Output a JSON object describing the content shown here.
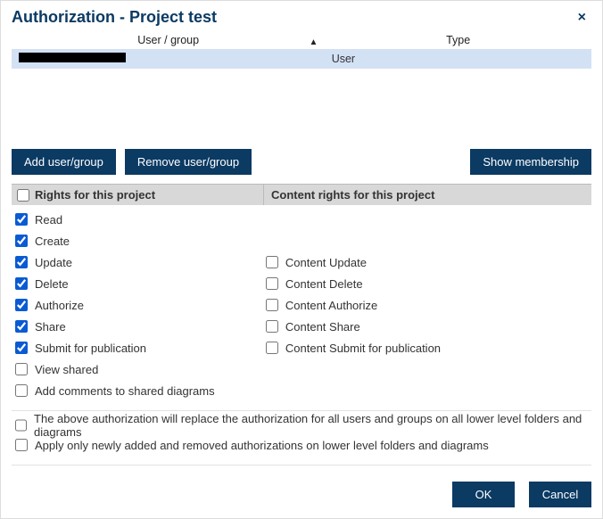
{
  "dialog": {
    "title": "Authorization - Project test",
    "close_glyph": "×"
  },
  "grid": {
    "col_user": "User / group",
    "col_type": "Type",
    "sort_glyph": "▲",
    "rows": [
      {
        "user": "████████████",
        "type": "User"
      }
    ]
  },
  "buttons": {
    "add": "Add user/group",
    "remove": "Remove user/group",
    "show_membership": "Show membership",
    "ok": "OK",
    "cancel": "Cancel"
  },
  "sections": {
    "rights": "Rights for this project",
    "content_rights": "Content rights for this project"
  },
  "rights": {
    "read": "Read",
    "create": "Create",
    "update": "Update",
    "delete": "Delete",
    "authorize": "Authorize",
    "share": "Share",
    "submit": "Submit for publication",
    "view_shared": "View shared",
    "add_comments": "Add comments to shared diagrams"
  },
  "content_rights": {
    "update": "Content Update",
    "delete": "Content Delete",
    "authorize": "Content Authorize",
    "share": "Content Share",
    "submit": "Content Submit for publication"
  },
  "options": {
    "replace_all": "The above authorization will replace the authorization for all users and groups on all lower level folders and diagrams",
    "apply_new": "Apply only newly added and removed authorizations on lower level folders and diagrams"
  }
}
